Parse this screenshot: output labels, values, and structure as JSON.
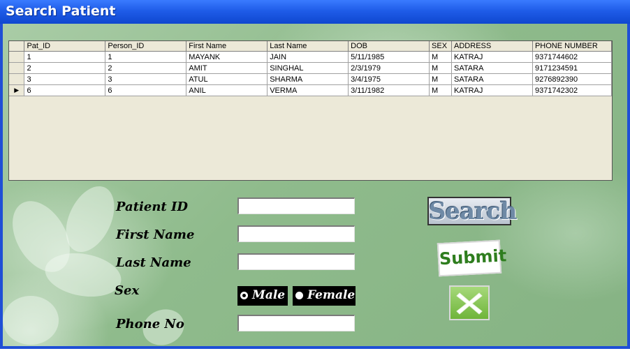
{
  "window": {
    "title": "Search Patient"
  },
  "grid": {
    "columns": [
      "Pat_ID",
      "Person_ID",
      "First Name",
      "Last Name",
      "DOB",
      "SEX",
      "ADDRESS",
      "PHONE NUMBER"
    ],
    "rows": [
      [
        "1",
        "1",
        "MAYANK",
        "JAIN",
        "5/11/1985",
        "M",
        "KATRAJ",
        "9371744602"
      ],
      [
        "2",
        "2",
        "AMIT",
        "SINGHAL",
        "2/3/1979",
        "M",
        "SATARA",
        "9171234591"
      ],
      [
        "3",
        "3",
        "ATUL",
        "SHARMA",
        "3/4/1975",
        "M",
        "SATARA",
        "9276892390"
      ],
      [
        "6",
        "6",
        "ANIL",
        "VERMA",
        "3/11/1982",
        "M",
        "KATRAJ",
        "9371742302"
      ]
    ],
    "current_row_index": 3
  },
  "form": {
    "patient_id_label": "Patient ID",
    "first_name_label": "First Name",
    "last_name_label": "Last Name",
    "sex_label": "Sex",
    "phone_label": "Phone No",
    "patient_id_value": "",
    "first_name_value": "",
    "last_name_value": "",
    "phone_value": "",
    "sex_options": {
      "male": "Male",
      "female": "Female"
    },
    "sex_selected": "Male"
  },
  "buttons": {
    "search": "Search",
    "submit": "Submit",
    "close_icon": "close-x-icon"
  },
  "colors": {
    "titlebar": "#1f5ce8",
    "background": "#8fbb8c",
    "submit_text": "#2e7d1e"
  }
}
